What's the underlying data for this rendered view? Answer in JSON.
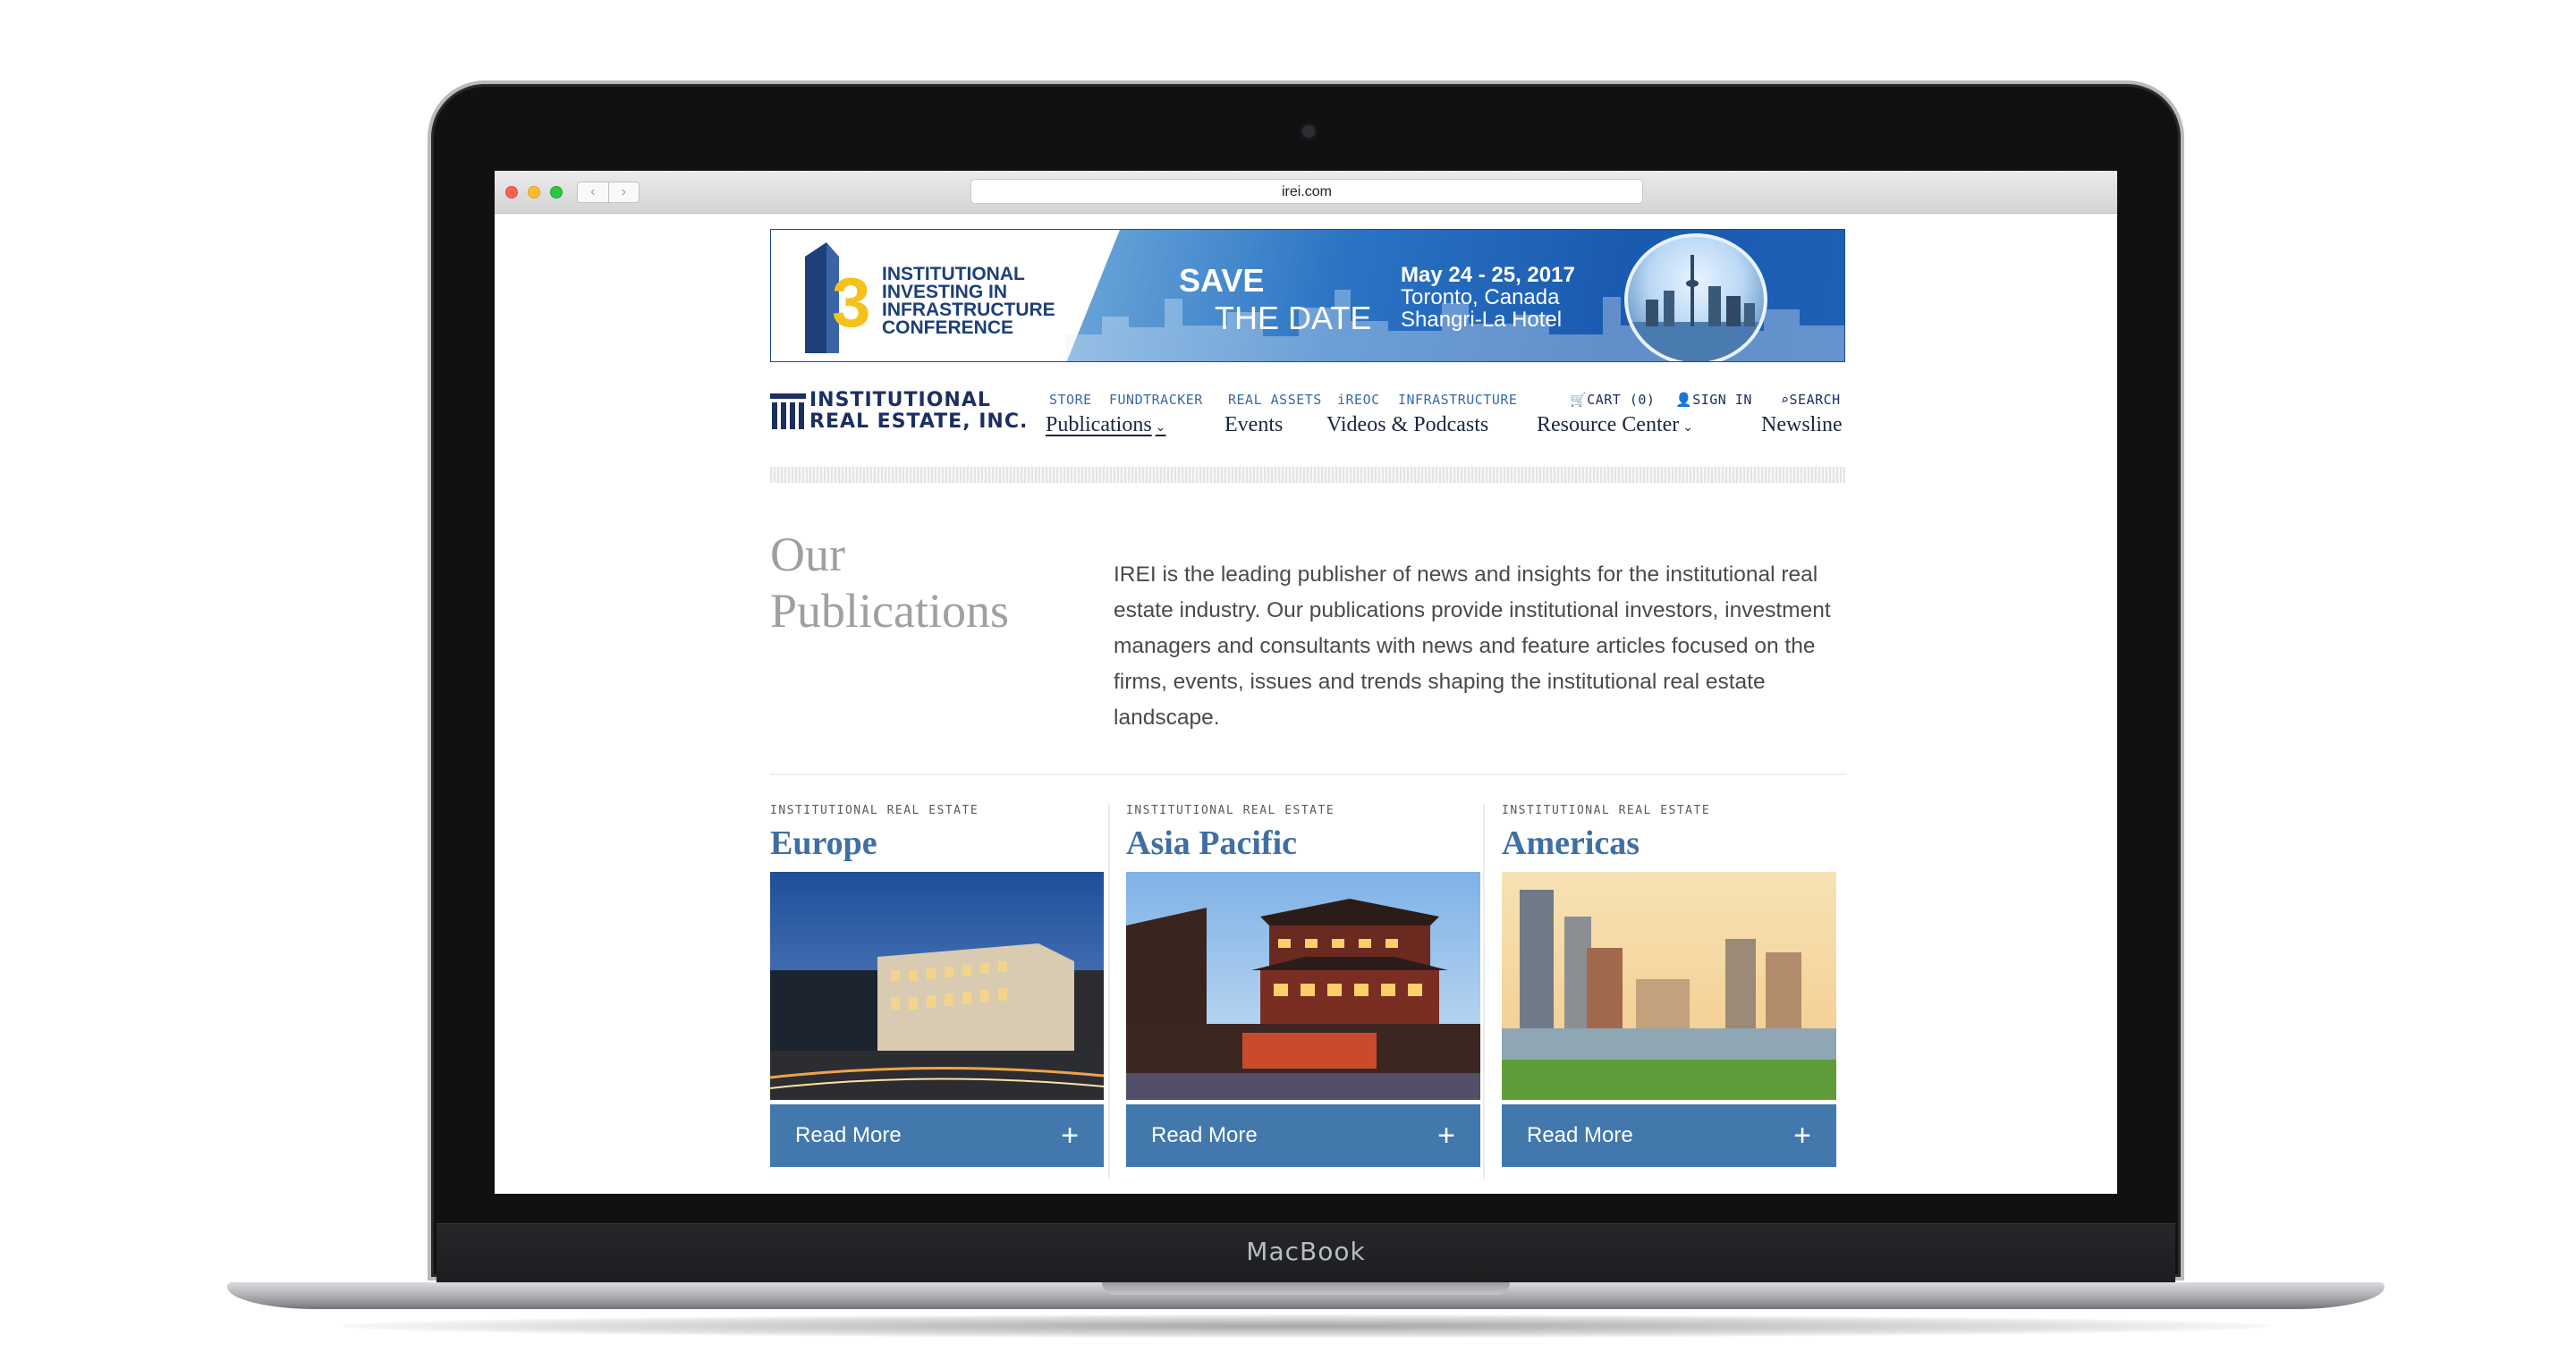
{
  "device": {
    "brand_label": "MacBook"
  },
  "browser": {
    "url": "irei.com",
    "back_glyph": "‹",
    "forward_glyph": "›"
  },
  "banner": {
    "title": "INSTITUTIONAL INVESTING IN INFRASTRUCTURE CONFERENCE",
    "logo_number": "3",
    "save": "SAVE",
    "the_date": "THE DATE",
    "dates": "May 24 - 25, 2017",
    "city": "Toronto, Canada",
    "venue": "Shangri-La Hotel"
  },
  "header": {
    "logo_line1": "INSTITUTIONAL",
    "logo_line2": "REAL ESTATE, INC.",
    "util_links": [
      "STORE",
      "FUNDTRACKER",
      "REAL ASSETS",
      "iREOC",
      "INFRASTRUCTURE"
    ],
    "cart": "CART (0)",
    "sign_in": "SIGN IN",
    "search": "SEARCH",
    "nav": {
      "publications": "Publications",
      "events": "Events",
      "videos": "Videos & Podcasts",
      "resource": "Resource Center",
      "newsline": "Newsline"
    }
  },
  "intro": {
    "title_line1": "Our",
    "title_line2": "Publications",
    "text": "IREI is the leading publisher of news and insights for the institutional real estate industry. Our publications provide institutional investors, investment managers and consultants with news and feature articles focused on the firms, events, issues and trends shaping the institutional real estate landscape."
  },
  "cards": [
    {
      "kicker": "INSTITUTIONAL REAL ESTATE",
      "title": "Europe",
      "cta": "Read More",
      "cta_icon": "+"
    },
    {
      "kicker": "INSTITUTIONAL REAL ESTATE",
      "title": "Asia Pacific",
      "cta": "Read More",
      "cta_icon": "+"
    },
    {
      "kicker": "INSTITUTIONAL REAL ESTATE",
      "title": "Americas",
      "cta": "Read More",
      "cta_icon": "+"
    }
  ],
  "colors": {
    "accent_blue": "#4278ac",
    "nav_navy": "#1c2f60",
    "link_blue": "#3a69a6",
    "heading_gray": "#a0a0a0"
  }
}
